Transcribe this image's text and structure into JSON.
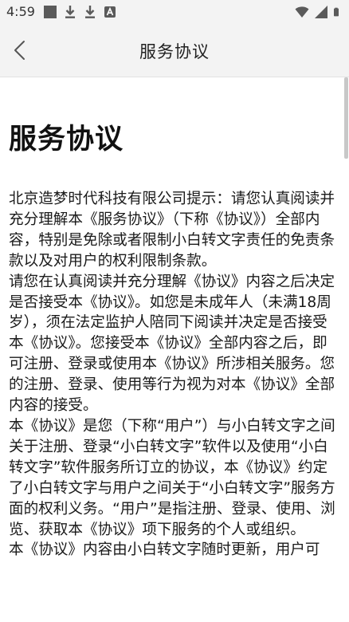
{
  "status_bar": {
    "time": "4:59",
    "left_icons": [
      "stop-square-icon",
      "download-icon",
      "download-icon",
      "app-a-icon"
    ],
    "right_icons": [
      "wifi-icon",
      "signal-icon",
      "battery-icon"
    ]
  },
  "nav": {
    "title": "服务协议",
    "back_icon": "chevron-left-icon"
  },
  "document": {
    "heading": "服务协议",
    "paragraphs": [
      "北京造梦时代科技有限公司提示：请您认真阅读并充分理解本《服务协议》（下称《协议》）全部内容，特别是免除或者限制小白转文字责任的免责条款以及对用户的权利限制条款。",
      "请您在认真阅读并充分理解《协议》内容之后决定是否接受本《协议》。如您是未成年人（未满18周岁），须在法定监护人陪同下阅读并决定是否接受本《协议》。您接受本《协议》全部内容之后，即可注册、登录或使用本《协议》所涉相关服务。您的注册、登录、使用等行为视为对本《协议》全部内容的接受。",
      "本《协议》是您（下称“用户”）与小白转文字之间关于注册、登录“小白转文字”软件以及使用“小白转文字”软件服务所订立的协议，本《协议》约定了小白转文字与用户之间关于“小白转文字”服务方面的权利义务。“用户”是指注册、登录、使用、浏览、获取本《协议》项下服务的个人或组织。",
      "本《协议》内容由小白转文字随时更新，用户可"
    ]
  },
  "colors": {
    "bar_background": "#f3f3f3",
    "page_background": "#ffffff",
    "text": "#1a1a1a"
  }
}
